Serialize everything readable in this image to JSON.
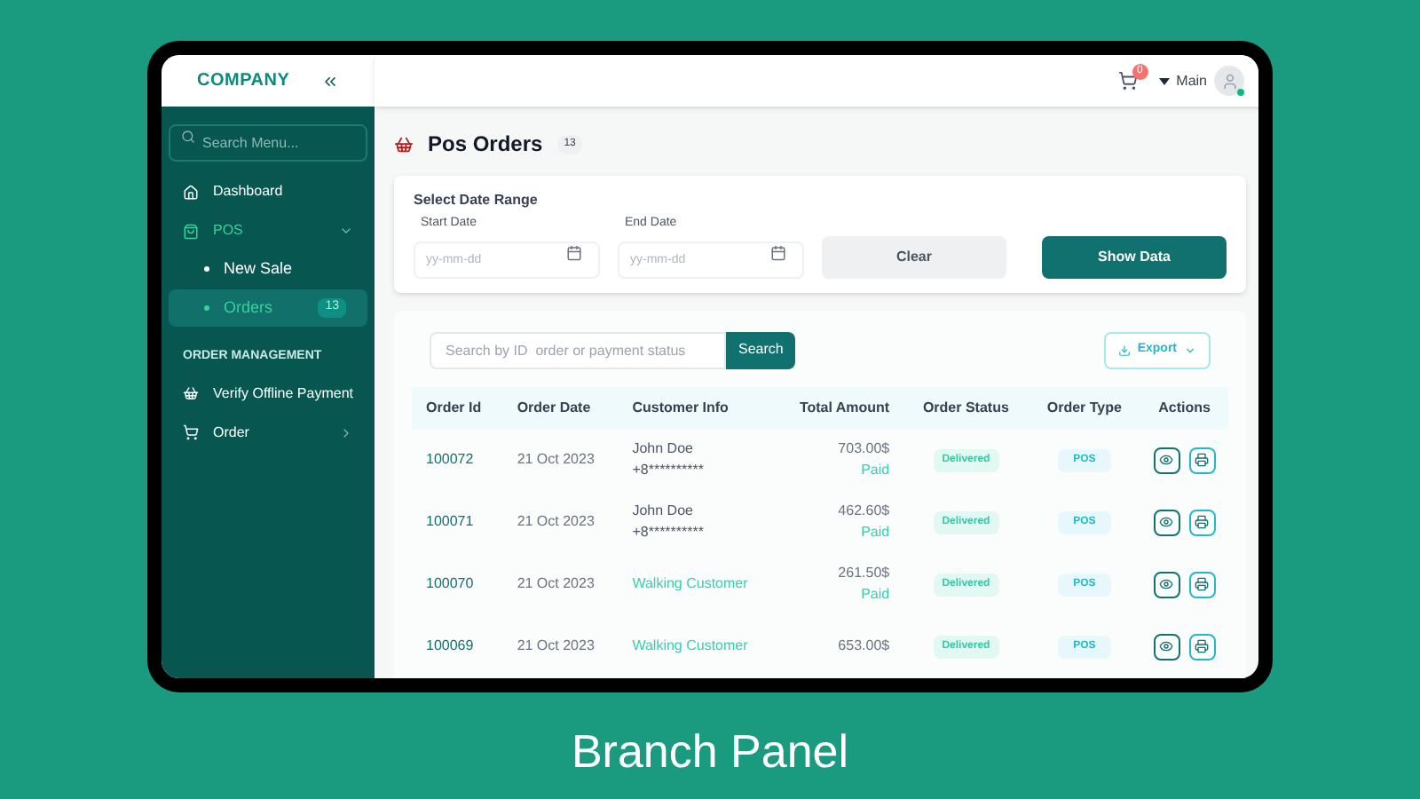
{
  "sidebar": {
    "logo": "COMPANY",
    "search": {
      "placeholder": "Search Menu..."
    },
    "items": [
      {
        "label": "Dashboard",
        "selected": false
      },
      {
        "label": "POS",
        "selected": true,
        "expanded": true,
        "children": [
          {
            "label": "New Sale",
            "selected": false
          },
          {
            "label": "Orders",
            "selected": true,
            "badge": "13"
          }
        ]
      }
    ],
    "section": "ORDER MANAGEMENT",
    "section_items": [
      {
        "label": "Verify Offline Payment",
        "selected": false
      },
      {
        "label": "Order",
        "selected": false,
        "expanded": false
      }
    ]
  },
  "header": {
    "cart_count": "0",
    "user": "Main"
  },
  "page": {
    "title": "Pos Orders",
    "count": "13"
  },
  "filter": {
    "title": "Select Date Range",
    "start": {
      "label": "Start Date",
      "placeholder": "yy-mm-dd"
    },
    "end": {
      "label": "End Date",
      "placeholder": "yy-mm-dd"
    },
    "buttons": [
      "Clear",
      "Show Data"
    ]
  },
  "table": {
    "search": {
      "placeholder": "Search by ID  order or payment status",
      "button": "Search"
    },
    "export": "Export",
    "columns": [
      "Order Id",
      "Order Date",
      "Customer Info",
      "Total Amount",
      "Order Status",
      "Order Type",
      "Actions"
    ],
    "rows": [
      {
        "id": "100072",
        "date": "21 Oct 2023",
        "customer": {
          "kind": "registered",
          "name": "John Doe",
          "phone": "+8**********"
        },
        "amount": "703.00$",
        "payment": "Paid",
        "status": "Delivered",
        "type": "POS"
      },
      {
        "id": "100071",
        "date": "21 Oct 2023",
        "customer": {
          "kind": "registered",
          "name": "John Doe",
          "phone": "+8**********"
        },
        "amount": "462.60$",
        "payment": "Paid",
        "status": "Delivered",
        "type": "POS"
      },
      {
        "id": "100070",
        "date": "21 Oct 2023",
        "customer": {
          "kind": "walk_in",
          "name": "Walking Customer"
        },
        "amount": "261.50$",
        "payment": "Paid",
        "status": "Delivered",
        "type": "POS"
      },
      {
        "id": "100069",
        "date": "21 Oct 2023",
        "customer": {
          "kind": "walk_in",
          "name": "Walking Customer"
        },
        "amount": "653.00$",
        "status": "Delivered",
        "type": "POS"
      }
    ]
  },
  "caption": "Branch Panel"
}
